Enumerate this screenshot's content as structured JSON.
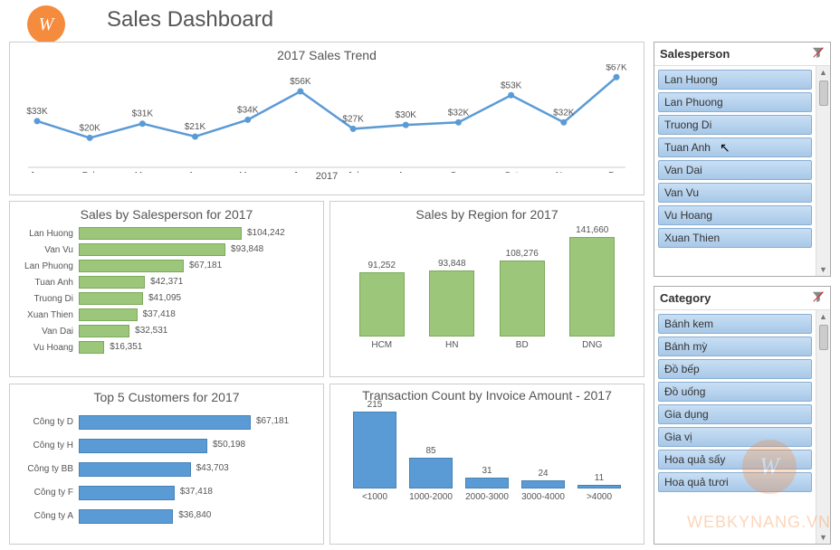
{
  "logo": {
    "mark": "W",
    "text": "WEBKYNANG.VN"
  },
  "title": "Sales Dashboard",
  "chart_data": [
    {
      "id": "trend",
      "type": "line",
      "title": "2017 Sales Trend",
      "categories": [
        "Jan",
        "Feb",
        "Mar",
        "Apr",
        "May",
        "Jun",
        "Jul",
        "Aug",
        "Sep",
        "Oct",
        "Nov",
        "Dec"
      ],
      "values": [
        33,
        20,
        31,
        21,
        34,
        56,
        27,
        30,
        32,
        53,
        32,
        67
      ],
      "labels": [
        "$33K",
        "$20K",
        "$31K",
        "$21K",
        "$34K",
        "$56K",
        "$27K",
        "$30K",
        "$32K",
        "$53K",
        "$32K",
        "$67K"
      ],
      "xlabel": "2017",
      "ylabel": "",
      "ylim": [
        0,
        70
      ]
    },
    {
      "id": "by_salesperson",
      "type": "bar",
      "orientation": "horizontal",
      "title": "Sales by Salesperson for 2017",
      "categories": [
        "Lan Huong",
        "Van Vu",
        "Lan Phuong",
        "Tuan Anh",
        "Truong Di",
        "Xuan Thien",
        "Van Dai",
        "Vu Hoang"
      ],
      "values": [
        104242,
        93848,
        67181,
        42371,
        41095,
        37418,
        32531,
        16351
      ],
      "labels": [
        "$104,242",
        "$93,848",
        "$67,181",
        "$42,371",
        "$41,095",
        "$37,418",
        "$32,531",
        "$16,351"
      ]
    },
    {
      "id": "by_region",
      "type": "bar",
      "title": "Sales by Region for 2017",
      "categories": [
        "HCM",
        "HN",
        "BD",
        "DNG"
      ],
      "values": [
        91252,
        93848,
        108276,
        141660
      ],
      "labels": [
        "91,252",
        "93,848",
        "108,276",
        "141,660"
      ]
    },
    {
      "id": "top5",
      "type": "bar",
      "orientation": "horizontal",
      "title": "Top 5 Customers for 2017",
      "categories": [
        "Công ty D",
        "Công ty H",
        "Công ty BB",
        "Công ty F",
        "Công ty A"
      ],
      "values": [
        67181,
        50198,
        43703,
        37418,
        36840
      ],
      "labels": [
        "$67,181",
        "$50,198",
        "$43,703",
        "$37,418",
        "$36,840"
      ]
    },
    {
      "id": "trans_count",
      "type": "bar",
      "title": "Transaction Count by Invoice Amount - 2017",
      "categories": [
        "<1000",
        "1000-2000",
        "2000-3000",
        "3000-4000",
        ">4000"
      ],
      "values": [
        215,
        85,
        31,
        24,
        11
      ],
      "labels": [
        "215",
        "85",
        "31",
        "24",
        "11"
      ]
    }
  ],
  "slicers": {
    "salesperson": {
      "title": "Salesperson",
      "items": [
        "Lan Huong",
        "Lan Phuong",
        "Truong Di",
        "Tuan Anh",
        "Van Dai",
        "Van Vu",
        "Vu Hoang",
        "Xuan Thien"
      ]
    },
    "category": {
      "title": "Category",
      "items": [
        "Bánh kem",
        "Bánh mỳ",
        "Đồ bếp",
        "Đồ uống",
        "Gia dụng",
        "Gia vị",
        "Hoa quả sấy",
        "Hoa quả tươi"
      ]
    }
  },
  "watermark": "WEBKYNANG.VN"
}
